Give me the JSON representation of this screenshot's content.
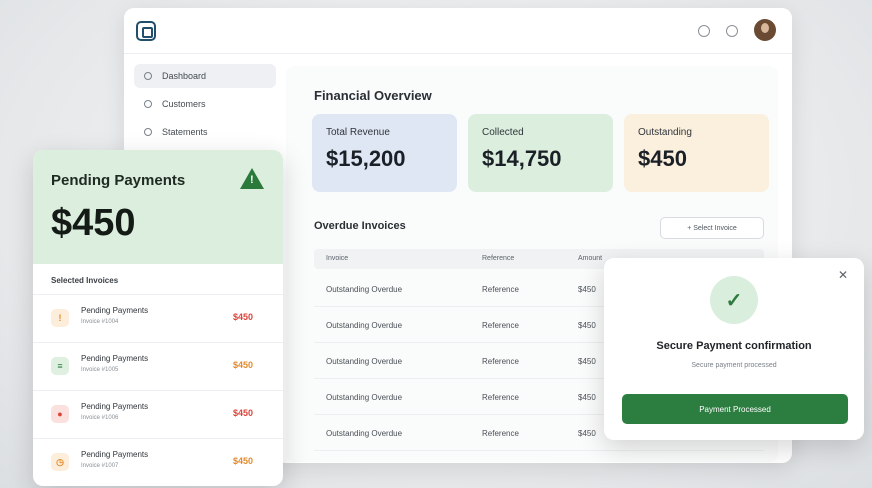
{
  "colors": {
    "accent_green": "#2c7d40",
    "danger_red": "#d9443a",
    "warning_orange": "#e28a2b",
    "card_blue": "#dfe7f4",
    "card_green": "#dcefdf",
    "card_orange": "#fbefdd"
  },
  "sidebar": {
    "items": [
      {
        "label": "Dashboard",
        "icon": "dashboard-icon"
      },
      {
        "label": "Customers",
        "icon": "customers-icon"
      },
      {
        "label": "Statements",
        "icon": "statements-icon"
      }
    ]
  },
  "overview": {
    "title": "Financial Overview",
    "stats": [
      {
        "label": "Total Revenue",
        "value": "$15,200"
      },
      {
        "label": "Collected",
        "value": "$14,750"
      },
      {
        "label": "Outstanding",
        "value": "$450"
      }
    ]
  },
  "invoices": {
    "title": "Overdue Invoices",
    "button_label": "+ Select Invoice",
    "columns": [
      "Invoice",
      "Reference",
      "Amount"
    ],
    "rows": [
      {
        "invoice": "Outstanding Overdue",
        "reference": "Reference",
        "amount": "$450"
      },
      {
        "invoice": "Outstanding Overdue",
        "reference": "Reference",
        "amount": "$450"
      },
      {
        "invoice": "Outstanding Overdue",
        "reference": "Reference",
        "amount": "$450"
      },
      {
        "invoice": "Outstanding Overdue",
        "reference": "Reference",
        "amount": "$450"
      },
      {
        "invoice": "Outstanding Overdue",
        "reference": "Reference",
        "amount": "$450"
      }
    ]
  },
  "pending": {
    "title": "Pending Payments",
    "amount": "$450",
    "subheading": "Selected Invoices",
    "items": [
      {
        "name": "Pending Payments",
        "sub": "Invoice #1004",
        "amount": "$450",
        "icon": "alert-icon"
      },
      {
        "name": "Pending Payments",
        "sub": "Invoice #1005",
        "amount": "$450",
        "icon": "document-icon"
      },
      {
        "name": "Pending Payments",
        "sub": "Invoice #1006",
        "amount": "$450",
        "icon": "error-icon"
      },
      {
        "name": "Pending Payments",
        "sub": "Invoice #1007",
        "amount": "$450",
        "icon": "clock-icon"
      }
    ]
  },
  "modal": {
    "title": "Secure Payment confirmation",
    "subtitle": "Secure payment processed",
    "button_label": "Payment Processed"
  }
}
